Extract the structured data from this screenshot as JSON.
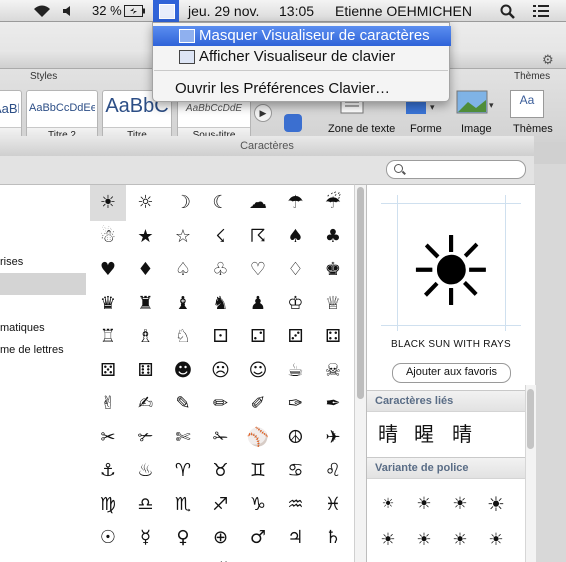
{
  "menubar": {
    "battery": "32 %",
    "date": "jeu. 29 nov.",
    "time": "13:05",
    "user": "Etienne OEHMICHEN",
    "icons": [
      "wifi-icon",
      "volume-icon",
      "battery-icon",
      "keyboard-viewer-icon",
      "search-icon",
      "list-icon"
    ]
  },
  "menu": {
    "items": [
      {
        "label": "Masquer Visualiseur de caractères",
        "highlighted": true
      },
      {
        "label": "Afficher Visualiseur de clavier",
        "highlighted": false
      },
      {
        "label": "Ouvrir les Préférences Clavier…",
        "highlighted": false
      }
    ]
  },
  "ribbon": {
    "group_styles": "Styles",
    "group_themes": "Thèmes",
    "style_samples": [
      {
        "sample": "AaBbCcDdEe",
        "caption": ""
      },
      {
        "sample": "AaBbCcDdEe",
        "caption": "Titre 2"
      },
      {
        "sample": "AaBbC",
        "caption": "Titre"
      },
      {
        "sample": "AaBbCcDdE",
        "caption": "Sous-titre"
      }
    ],
    "buttons": {
      "textbox": "Zone de texte",
      "shape": "Forme",
      "image": "Image",
      "themes": "Thèmes"
    }
  },
  "viewer": {
    "title": "Caractères",
    "search_placeholder": "",
    "categories": [
      {
        "label": "rises",
        "selected": false
      },
      {
        "label": "",
        "selected": true
      },
      {
        "label": "matiques",
        "selected": false
      },
      {
        "label": "me de lettres",
        "selected": false
      }
    ],
    "glyphs": [
      [
        "☀",
        "☼",
        "☽",
        "☾",
        "☁",
        "☂",
        "☔"
      ],
      [
        "☃",
        "★",
        "☆",
        "☇",
        "☈",
        "♠",
        "♣"
      ],
      [
        "♥",
        "♦",
        "♤",
        "♧",
        "♡",
        "♢",
        "♚"
      ],
      [
        "♛",
        "♜",
        "♝",
        "♞",
        "♟",
        "♔",
        "♕"
      ],
      [
        "♖",
        "♗",
        "♘",
        "⚀",
        "⚁",
        "⚂",
        "⚃"
      ],
      [
        "⚄",
        "⚅",
        "☻",
        "☹",
        "☺",
        "☕",
        "☠"
      ],
      [
        "✌",
        "✍",
        "✎",
        "✏",
        "✐",
        "✑",
        "✒"
      ],
      [
        "✂",
        "✃",
        "✄",
        "✁",
        "⚾",
        "☮",
        "✈"
      ],
      [
        "⚓",
        "♨",
        "♈",
        "♉",
        "♊",
        "♋",
        "♌"
      ],
      [
        "♍",
        "♎",
        "♏",
        "♐",
        "♑",
        "♒",
        "♓"
      ],
      [
        "☉",
        "☿",
        "♀",
        "⊕",
        "♂",
        "♃",
        "♄"
      ],
      [
        "♅",
        "♆",
        "♇",
        "☄",
        "☊",
        "☋",
        "☌"
      ]
    ],
    "selected_glyph": "☀",
    "character_name": "BLACK SUN WITH RAYS",
    "favorite_button": "Ajouter aux favoris",
    "related_heading": "Caractères liés",
    "related": [
      "晴",
      "暒",
      "晴"
    ],
    "font_variant_heading": "Variante de police",
    "variants": [
      "☀",
      "☀",
      "☀",
      "☀",
      "☀",
      "☀",
      "☀",
      "☀"
    ]
  }
}
